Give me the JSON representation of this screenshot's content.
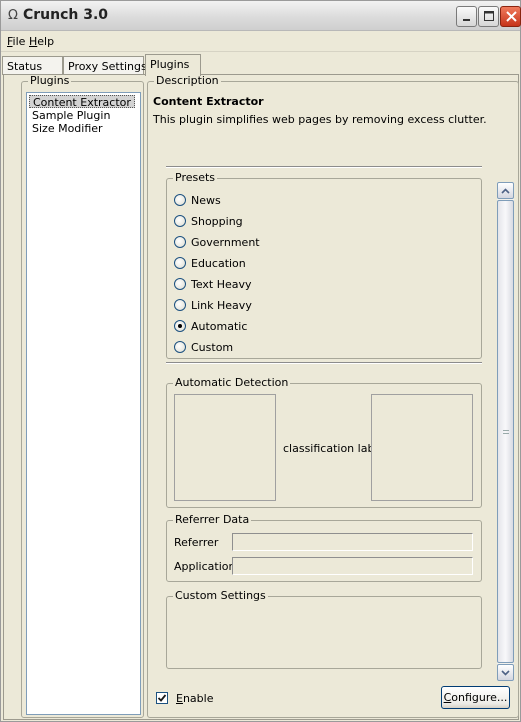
{
  "window": {
    "title": "Crunch 3.0",
    "app_icon": "omega-icon",
    "controls": [
      "minimize-icon",
      "maximize-icon",
      "close-icon"
    ]
  },
  "menu": {
    "file": {
      "mnemonic": "F",
      "rest": "ile"
    },
    "help": {
      "mnemonic": "H",
      "rest": "elp"
    }
  },
  "tabs": [
    {
      "label": "Status"
    },
    {
      "label": "Proxy Settings"
    },
    {
      "label": "Plugins",
      "active": true
    }
  ],
  "plugins_panel": {
    "legend": "Plugins",
    "items": [
      "Content Extractor",
      "Sample Plugin",
      "Size Modifier"
    ],
    "selected_index": 0
  },
  "description": {
    "legend": "Description",
    "title": "Content Extractor",
    "text": "This plugin simplifies web pages by removing excess clutter."
  },
  "presets": {
    "legend": "Presets",
    "options": [
      "News",
      "Shopping",
      "Government",
      "Education",
      "Text Heavy",
      "Link Heavy",
      "Automatic",
      "Custom"
    ],
    "selected": "Automatic"
  },
  "automatic_detection": {
    "legend": "Automatic Detection",
    "classification_label": "classification label"
  },
  "referrer_data": {
    "legend": "Referrer Data",
    "referrer_label": "Referrer",
    "referrer_value": "",
    "application_label": "Application",
    "application_value": ""
  },
  "custom_settings": {
    "legend": "Custom Settings"
  },
  "footer": {
    "enable": {
      "mnemonic": "E",
      "rest": "nable",
      "checked": true
    },
    "configure": {
      "mnemonic": "C",
      "rest": "onfigure..."
    }
  },
  "colors": {
    "selection_bg": "#d3d3d3",
    "window_bg": "#ece9d8",
    "close_button": "#c6341a"
  }
}
